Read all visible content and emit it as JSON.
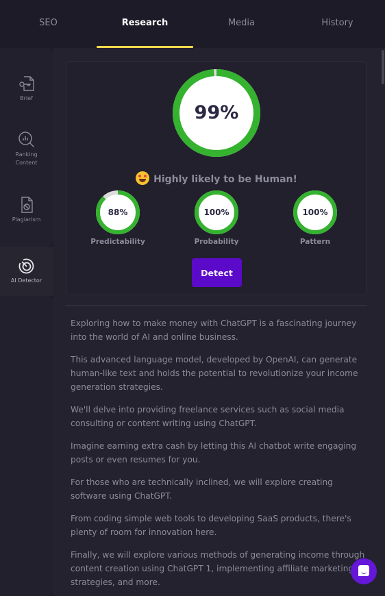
{
  "tabs": [
    {
      "label": "SEO",
      "active": false
    },
    {
      "label": "Research",
      "active": true
    },
    {
      "label": "Media",
      "active": false
    },
    {
      "label": "History",
      "active": false
    }
  ],
  "sidebar": {
    "items": [
      {
        "label": "Brief",
        "icon": "brief-document-key-icon"
      },
      {
        "label_line1": "Ranking",
        "label_line2": "Content",
        "icon": "ranking-chart-search-icon"
      },
      {
        "label": "Plagiarism",
        "icon": "plagiarism-document-icon"
      },
      {
        "label": "AI Detector",
        "icon": "ai-detector-radar-icon",
        "active": true
      }
    ]
  },
  "detector": {
    "overall_score": 99,
    "overall_label": "99%",
    "verdict_text": "Highly likely to be Human!",
    "verdict_emoji": "star-struck",
    "metrics": [
      {
        "name": "Predictability",
        "value": 88,
        "label": "88%"
      },
      {
        "name": "Probability",
        "value": 100,
        "label": "100%"
      },
      {
        "name": "Pattern",
        "value": 100,
        "label": "100%"
      }
    ],
    "detect_button": "Detect"
  },
  "colors": {
    "ring_fill": "#35b22f",
    "ring_track": "#dcdcdc",
    "tab_underline": "#f1d84a",
    "button": "#5b0ac9",
    "chat_fab": "#6417d8"
  },
  "content": {
    "paragraphs": [
      "Exploring how to make money with ChatGPT is a fascinating journey into the world of AI and online business.",
      "This advanced language model, developed by OpenAI, can generate human-like text and holds the potential to revolutionize your income generation strategies.",
      "We'll delve into providing freelance services such as social media consulting or content writing using ChatGPT.",
      "Imagine earning extra cash by letting this AI chatbot write engaging posts or even resumes for you.",
      "For those who are technically inclined, we will explore creating software using ChatGPT.",
      "From coding simple web tools to developing SaaS products, there's plenty of room for innovation here.",
      "Finally, we will explore various methods of generating income through content creation using ChatGPT 1, implementing affiliate marketing strategies, and more."
    ]
  }
}
